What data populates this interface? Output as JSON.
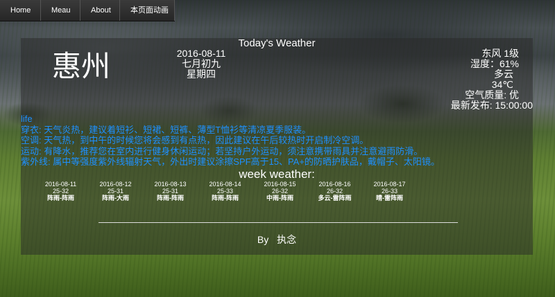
{
  "nav": {
    "items": [
      "Home",
      "Meau",
      "About",
      "本页面动画"
    ]
  },
  "panel": {
    "title": "Today's Weather",
    "city": "惠州",
    "date": "2016-08-11",
    "lunar": "七月初九",
    "weekday": "星期四",
    "wind": "东风 1级",
    "humidity": "湿度：61%",
    "condition": "多云",
    "temperature": "34℃",
    "air_quality": "空气质量: 优",
    "published": "最新发布: 15:00:00"
  },
  "life": {
    "heading": "life",
    "items": [
      "穿衣: 天气炎热，建议着短衫、短裙、短裤、薄型T恤衫等清凉夏季服装。",
      "空调: 天气热，到中午的时候您将会感到有点热，因此建议在午后较热时开启制冷空调。",
      "运动: 有降水，推荐您在室内进行健身休闲运动；若坚持户外运动，须注意携带雨具并注意避雨防滑。",
      "紫外线: 属中等强度紫外线辐射天气，外出时建议涂擦SPF高于15、PA+的防晒护肤品，戴帽子、太阳镜。"
    ]
  },
  "week": {
    "title": "week weather:",
    "days": [
      {
        "date": "2016-08-11",
        "temp": "25-32",
        "cond": "阵雨-阵雨"
      },
      {
        "date": "2016-08-12",
        "temp": "25-31",
        "cond": "阵雨-大雨"
      },
      {
        "date": "2016-08-13",
        "temp": "25-31",
        "cond": "阵雨-阵雨"
      },
      {
        "date": "2016-08-14",
        "temp": "25-33",
        "cond": "阵雨-阵雨"
      },
      {
        "date": "2016-08-15",
        "temp": "26-32",
        "cond": "中雨-阵雨"
      },
      {
        "date": "2016-08-16",
        "temp": "26-32",
        "cond": "多云-雷阵雨"
      },
      {
        "date": "2016-08-17",
        "temp": "26-33",
        "cond": "晴-雷阵雨"
      }
    ]
  },
  "footer": {
    "text": "By 执念"
  }
}
